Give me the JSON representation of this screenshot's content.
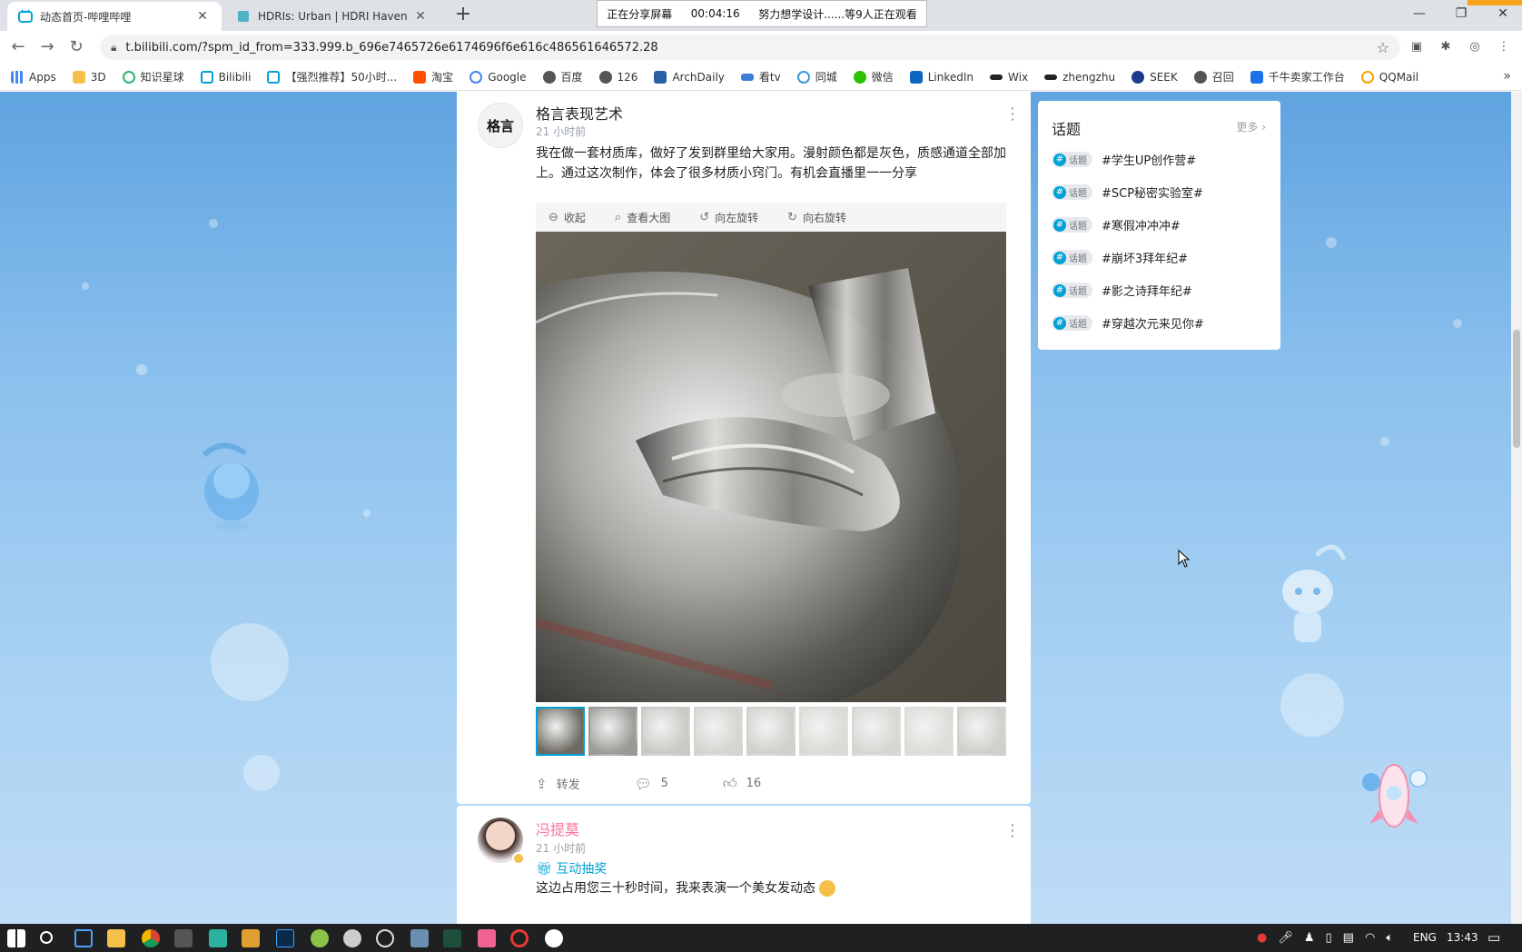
{
  "browser": {
    "tabs": [
      {
        "title": "动态首页-哔哩哔哩",
        "active": true
      },
      {
        "title": "HDRIs: Urban | HDRI Haven",
        "active": false
      }
    ],
    "share_banner": {
      "status": "正在分享屏幕",
      "time": "00:04:16",
      "viewers": "努力想学设计......等9人正在观看"
    },
    "url": "t.bilibili.com/?spm_id_from=333.999.b_696e7465726e6174696f6e616c486561646572.28",
    "bookmarks": [
      "Apps",
      "3D",
      "知识星球",
      "Bilibili",
      "【强烈推荐】50小时...",
      "淘宝",
      "Google",
      "百度",
      "126",
      "ArchDaily",
      "看tv",
      "同城",
      "微信",
      "LinkedIn",
      "Wix",
      "zhengzhu",
      "SEEK",
      "召回",
      "千牛卖家工作台",
      "QQMail"
    ],
    "bookmarks_more": "»"
  },
  "feed": {
    "post1": {
      "avatar_text": "格言",
      "username": "格言表现艺术",
      "time": "21 小时前",
      "text": "我在做一套材质库，做好了发到群里给大家用。漫射颜色都是灰色，质感通道全部加上。通过这次制作，体会了很多材质小窍门。有机会直播里一一分享",
      "image_toolbar": [
        "收起",
        "查看大图",
        "向左旋转",
        "向右旋转"
      ],
      "thumb_count": 9,
      "actions": {
        "repost": "转发",
        "comments": "5",
        "likes": "16"
      }
    },
    "post2": {
      "username": "冯提莫",
      "time": "21 小时前",
      "lottery": "互动抽奖",
      "text": "这边占用您三十秒时间，我来表演一个美女发动态"
    }
  },
  "topics": {
    "title": "话题",
    "more": "更多",
    "tag_label": "话题",
    "items": [
      "#学生UP创作营#",
      "#SCP秘密实验室#",
      "#寒假冲冲冲#",
      "#崩坏3拜年纪#",
      "#影之诗拜年纪#",
      "#穿越次元来见你#"
    ]
  },
  "taskbar": {
    "lang": "ENG",
    "time": "13:43"
  },
  "colors": {
    "bilibili_blue": "#00a1d6",
    "bilibili_pink": "#fb7299",
    "background_sky": "#8cc1ee"
  }
}
